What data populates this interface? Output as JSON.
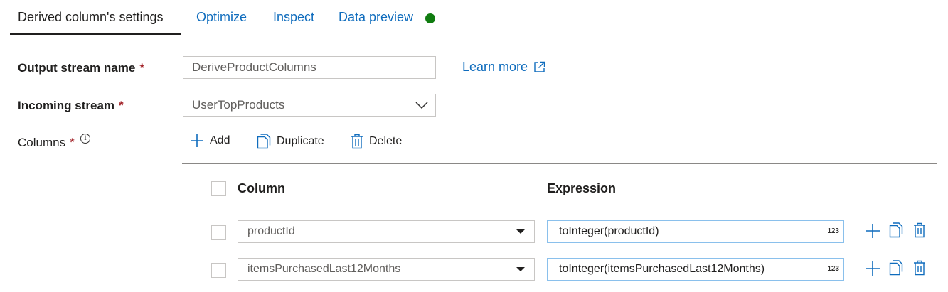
{
  "tabs": [
    {
      "label": "Derived column's settings",
      "active": true
    },
    {
      "label": "Optimize"
    },
    {
      "label": "Inspect"
    },
    {
      "label": "Data preview"
    }
  ],
  "status_color": "#107c10",
  "form": {
    "output_stream": {
      "label": "Output stream name",
      "value": "DeriveProductColumns"
    },
    "incoming_stream": {
      "label": "Incoming stream",
      "value": "UserTopProducts"
    },
    "columns_label": "Columns",
    "required_mark": "*",
    "learn_more": "Learn more"
  },
  "toolbar": {
    "add": "Add",
    "duplicate": "Duplicate",
    "delete": "Delete"
  },
  "grid": {
    "headers": {
      "column": "Column",
      "expression": "Expression"
    },
    "rows": [
      {
        "column": "productId",
        "expression": "toInteger(productId)",
        "type": "123"
      },
      {
        "column": "itemsPurchasedLast12Months",
        "expression": "toInteger(itemsPurchasedLast12Months)",
        "type": "123"
      }
    ]
  },
  "accent_color": "#0f6cbd"
}
